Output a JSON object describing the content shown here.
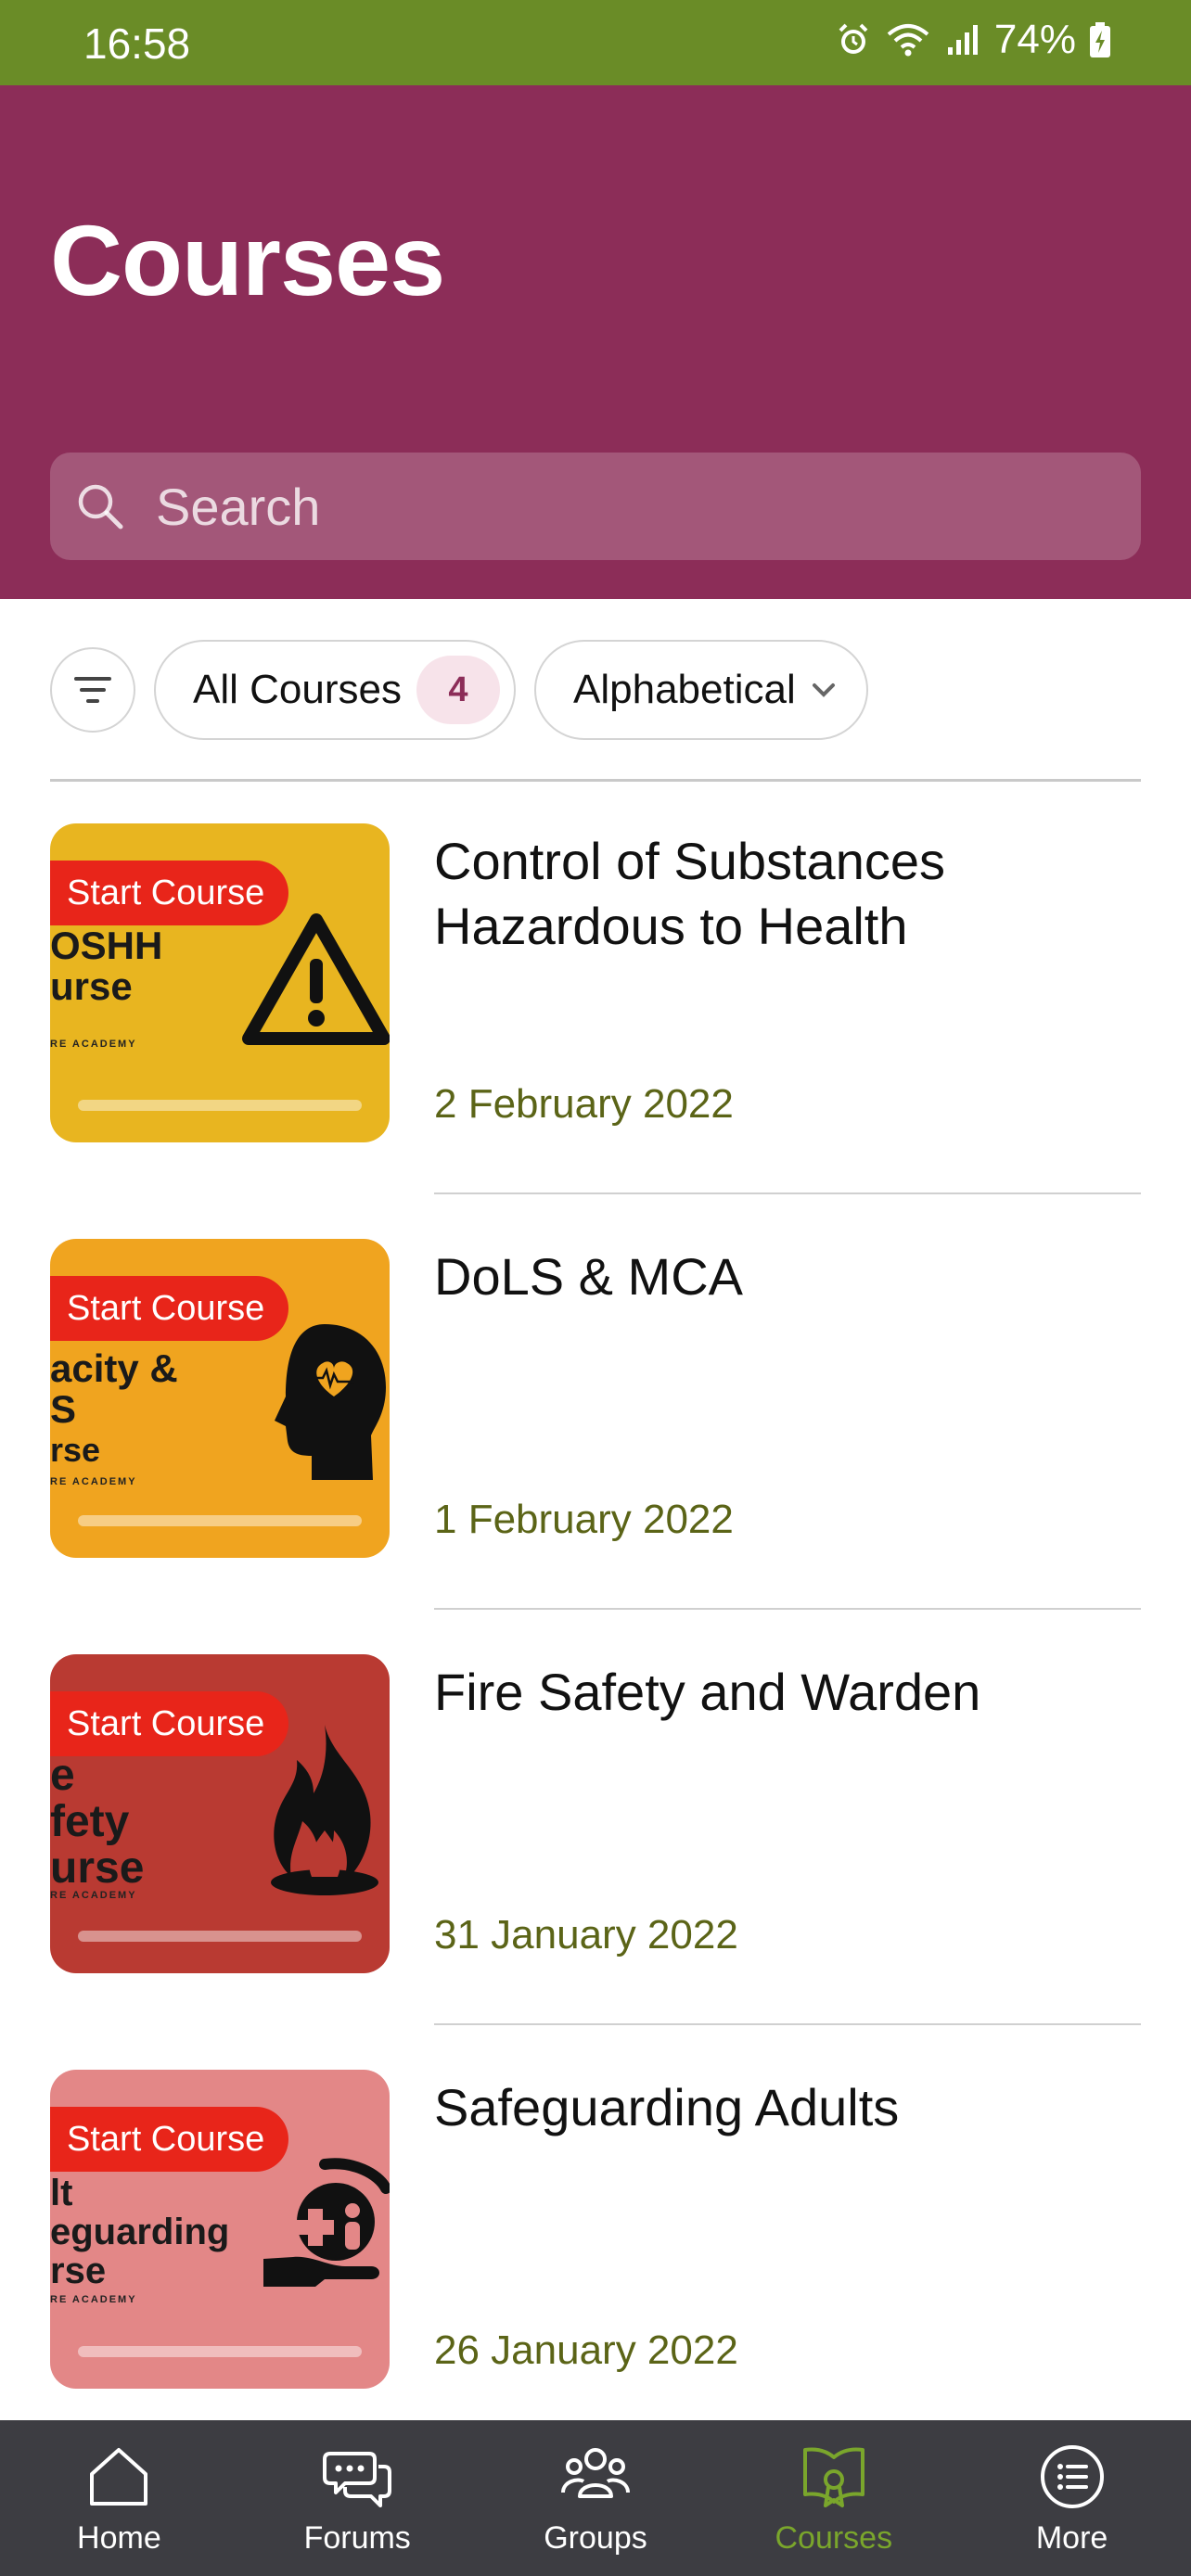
{
  "status_bar": {
    "time": "16:58",
    "battery": "74%"
  },
  "header": {
    "title": "Courses"
  },
  "search": {
    "placeholder": "Search"
  },
  "filters": {
    "all_courses_label": "All Courses",
    "course_count": "4",
    "sort_label": "Alphabetical"
  },
  "courses": [
    {
      "title": "Control of Substances Hazardous to Health",
      "date": "2 February 2022",
      "badge": "Start Course",
      "thumb_line1": "OSHH",
      "thumb_line2": "urse",
      "thumb_line3": "",
      "thumb_small": "RE ACADEMY",
      "thumb_color": "#e8b520",
      "icon": "warning-icon"
    },
    {
      "title": "DoLS & MCA",
      "date": "1 February 2022",
      "badge": "Start Course",
      "thumb_line1": "acity &",
      "thumb_line2": "S",
      "thumb_line3": "rse",
      "thumb_small": "RE ACADEMY",
      "thumb_color": "#f0a41f",
      "icon": "head-heart-icon"
    },
    {
      "title": "Fire Safety and Warden",
      "date": "31 January 2022",
      "badge": "Start Course",
      "thumb_line1": "e",
      "thumb_line2": "fety",
      "thumb_line3": "urse",
      "thumb_small": "RE ACADEMY",
      "thumb_color": "#b93a32",
      "icon": "flame-icon"
    },
    {
      "title": "Safeguarding Adults",
      "date": "26 January 2022",
      "badge": "Start Course",
      "thumb_line1": "lt",
      "thumb_line2": "eguarding",
      "thumb_line3": "rse",
      "thumb_small": "RE ACADEMY",
      "thumb_color": "#e38787",
      "icon": "hand-care-icon"
    }
  ],
  "bottom_nav": [
    {
      "label": "Home",
      "icon": "home-icon",
      "active": false
    },
    {
      "label": "Forums",
      "icon": "forums-icon",
      "active": false
    },
    {
      "label": "Groups",
      "icon": "groups-icon",
      "active": false
    },
    {
      "label": "Courses",
      "icon": "courses-icon",
      "active": true
    },
    {
      "label": "More",
      "icon": "more-icon",
      "active": false
    }
  ]
}
